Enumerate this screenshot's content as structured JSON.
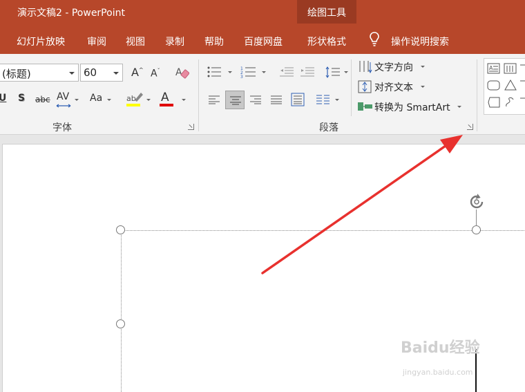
{
  "window": {
    "title": "演示文稿2  -  PowerPoint",
    "contextual_group": "绘图工具"
  },
  "tabs": [
    {
      "label": "幻灯片放映"
    },
    {
      "label": "审阅"
    },
    {
      "label": "视图"
    },
    {
      "label": "录制"
    },
    {
      "label": "帮助"
    },
    {
      "label": "百度网盘"
    },
    {
      "label": "形状格式",
      "active": true
    }
  ],
  "tell_me": "操作说明搜索",
  "font_group": {
    "label": "字体",
    "font_name": "(标题)",
    "font_size": "60",
    "bold": "U",
    "shadow": "S",
    "strikethrough": "abc",
    "spacing": "AV",
    "change_case": "Aa",
    "grow": "A",
    "shrink": "A",
    "font_color": "A"
  },
  "paragraph_group": {
    "label": "段落",
    "text_direction": "文字方向",
    "align_text": "对齐文本",
    "convert_smartart": "转换为 SmartArt"
  },
  "colors": {
    "accent": "#b7472a",
    "highlight": "#ffff00",
    "font_color": "#e00000",
    "arrow": "#e8312e"
  },
  "watermark": {
    "brand": "Baidu经验",
    "url": "jingyan.baidu.com"
  }
}
